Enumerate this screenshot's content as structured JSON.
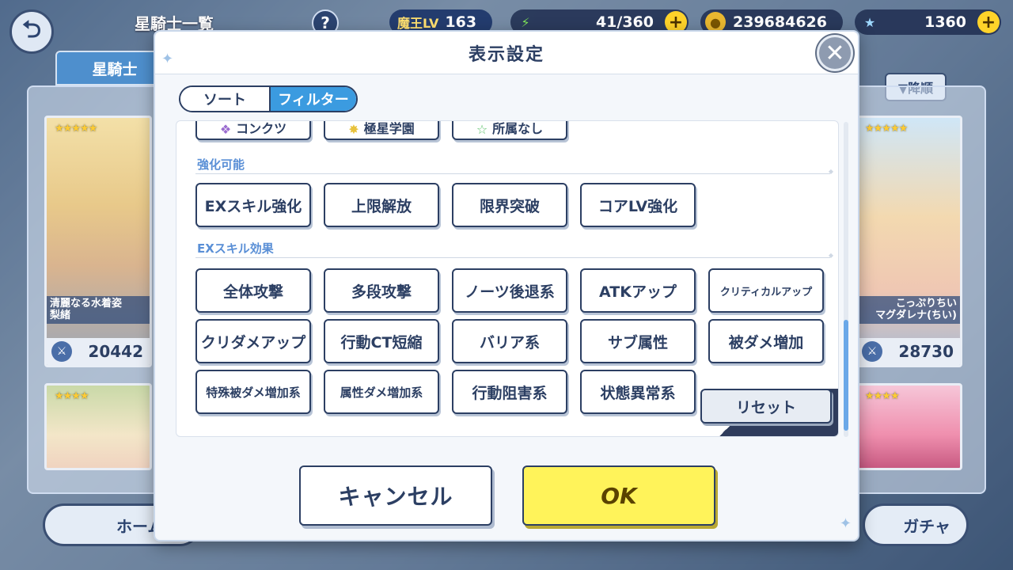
{
  "header": {
    "screen_title": "星騎士一覧",
    "back_icon": "back-arrow-icon",
    "help_label": "?",
    "maou_lv_label": "魔王LV",
    "maou_lv_value": "163",
    "stamina": "41/360",
    "coins": "239684626",
    "gems": "1360",
    "plus_label": "+"
  },
  "tabs": {
    "knight_tab": "星騎士"
  },
  "sort_order": "▼降順",
  "cards": [
    {
      "name": "清麗なる水着姿\n梨緒",
      "power": "20442"
    },
    {
      "name": "こっぷりちい\nマグダレナ(ちい)",
      "power": "28730"
    }
  ],
  "bottom_nav": {
    "home": "ホーム",
    "gacha": "ガチャ"
  },
  "modal": {
    "title": "表示設定",
    "close_label": "✕",
    "segments": {
      "sort": "ソート",
      "filter": "フィルター"
    },
    "cut_row": [
      "コンクツ",
      "極星学園",
      "所属なし"
    ],
    "sections": [
      {
        "label": "強化可能",
        "buttons": [
          "EXスキル強化",
          "上限解放",
          "限界突破",
          "コアLV強化"
        ]
      },
      {
        "label": "EXスキル効果",
        "buttons": [
          "全体攻撃",
          "多段攻撃",
          "ノーツ後退系",
          "ATKアップ",
          "クリティカルアップ",
          "クリダメアップ",
          "行動CT短縮",
          "バリア系",
          "サブ属性",
          "被ダメ増加",
          "特殊被ダメ増加系",
          "属性ダメ増加系",
          "行動阻害系",
          "状態異常系"
        ]
      }
    ],
    "reset_label": "リセット",
    "cancel_label": "キャンセル",
    "ok_label": "OK"
  },
  "colors": {
    "navy": "#2c3f63",
    "filter_active": "#3b9be0",
    "ok_yellow": "#fff35a",
    "section_label": "#5a8fd6"
  }
}
